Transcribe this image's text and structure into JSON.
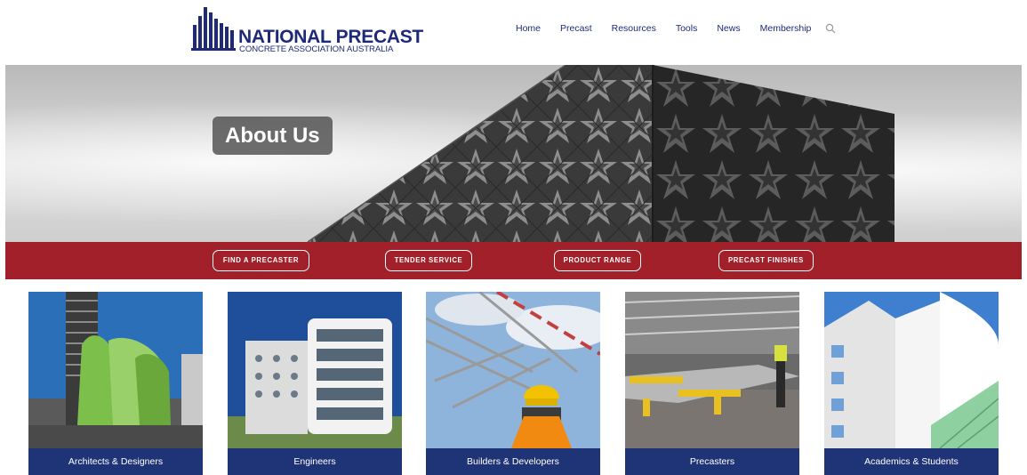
{
  "header": {
    "logo": {
      "line1": "NATIONAL PRECAST",
      "line2": "CONCRETE ASSOCIATION AUSTRALIA"
    },
    "nav": [
      {
        "label": "Home"
      },
      {
        "label": "Precast"
      },
      {
        "label": "Resources"
      },
      {
        "label": "Tools"
      },
      {
        "label": "News"
      },
      {
        "label": "Membership"
      }
    ],
    "search_icon": "search-icon"
  },
  "hero": {
    "title": "About Us"
  },
  "band": {
    "buttons": [
      {
        "label": "FIND A PRECASTER"
      },
      {
        "label": "TENDER SERVICE"
      },
      {
        "label": "PRODUCT RANGE"
      },
      {
        "label": "PRECAST FINISHES"
      }
    ]
  },
  "cards": [
    {
      "label": "Architects & Designers"
    },
    {
      "label": "Engineers"
    },
    {
      "label": "Builders & Developers"
    },
    {
      "label": "Precasters"
    },
    {
      "label": "Academics & Students"
    }
  ],
  "colors": {
    "brand_navy": "#1e2a78",
    "band_red": "#a1202a",
    "card_label_bg": "#1f3476"
  }
}
